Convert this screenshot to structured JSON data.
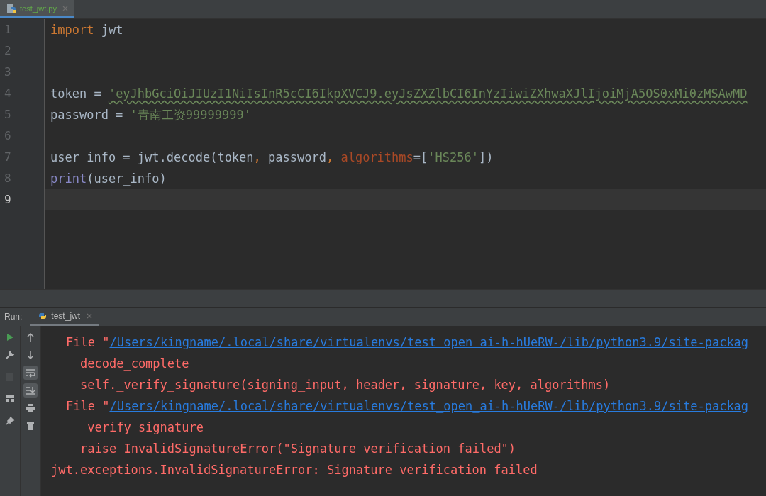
{
  "editor_tab": {
    "label": "test_jwt.py",
    "selected": true
  },
  "editor": {
    "lines": [
      {
        "number": "1",
        "current": false,
        "tokens": [
          {
            "kind": "keyword",
            "text": "import"
          },
          {
            "kind": "plain",
            "text": " jwt"
          }
        ]
      },
      {
        "number": "2",
        "current": false
      },
      {
        "number": "3",
        "current": false
      },
      {
        "number": "4",
        "current": false,
        "tokens": [
          {
            "kind": "plain",
            "text": "token = "
          },
          {
            "kind": "typo_string",
            "text": "'eyJhbGciOiJIUzI1NiIsInR5cCI6IkpXVCJ9.eyJsZXZlbCI6InYzIiwiZXhwaXJlIjoiMjA5OS0xMi0zMSAwMD"
          }
        ]
      },
      {
        "number": "5",
        "current": false,
        "tokens": [
          {
            "kind": "plain",
            "text": "password = "
          },
          {
            "kind": "string",
            "text": "'青南工资99999999'"
          }
        ]
      },
      {
        "number": "6",
        "current": false
      },
      {
        "number": "7",
        "current": false,
        "tokens": [
          {
            "kind": "plain",
            "text": "user_info = jwt.decode(token"
          },
          {
            "kind": "keyword",
            "text": ", "
          },
          {
            "kind": "plain",
            "text": "password"
          },
          {
            "kind": "keyword",
            "text": ", "
          },
          {
            "kind": "param",
            "text": "algorithms"
          },
          {
            "kind": "plain",
            "text": "=["
          },
          {
            "kind": "string",
            "text": "'HS256'"
          },
          {
            "kind": "plain",
            "text": "])"
          }
        ]
      },
      {
        "number": "8",
        "current": false,
        "tokens": [
          {
            "kind": "builtin",
            "text": "print"
          },
          {
            "kind": "plain",
            "text": "(user_info)"
          }
        ]
      },
      {
        "number": "9",
        "current": true
      }
    ]
  },
  "run_panel": {
    "label": "Run:",
    "tab": {
      "label": "test_jwt",
      "selected": true
    },
    "actions": [
      {
        "kind": "run",
        "disabled": false
      },
      {
        "kind": "wrench",
        "disabled": false
      },
      {
        "kind": "stop",
        "disabled": true
      },
      {
        "kind": "layout",
        "disabled": false
      },
      {
        "kind": "pin",
        "disabled": false
      }
    ],
    "tools": [
      {
        "kind": "up",
        "on": false
      },
      {
        "kind": "down",
        "on": false
      },
      {
        "kind": "wrap",
        "on": true
      },
      {
        "kind": "scroll_end",
        "on": true
      },
      {
        "kind": "print",
        "on": false
      },
      {
        "kind": "trash",
        "on": false
      }
    ],
    "console_lines": [
      {
        "kind": "file",
        "prefix": "File \"",
        "link": "/Users/kingname/.local/share/virtualenvs/test_open_ai-h-hUeRW-/lib/python3.9/site-packag"
      },
      {
        "kind": "code",
        "text": "decode_complete"
      },
      {
        "kind": "code",
        "text": "self._verify_signature(signing_input, header, signature, key, algorithms)"
      },
      {
        "kind": "file",
        "prefix": "File \"",
        "link": "/Users/kingname/.local/share/virtualenvs/test_open_ai-h-hUeRW-/lib/python3.9/site-packag"
      },
      {
        "kind": "code",
        "text": "_verify_signature"
      },
      {
        "kind": "code",
        "text": "raise InvalidSignatureError(\"Signature verification failed\")"
      },
      {
        "kind": "error",
        "text": "jwt.exceptions.InvalidSignatureError: Signature verification failed"
      }
    ]
  }
}
